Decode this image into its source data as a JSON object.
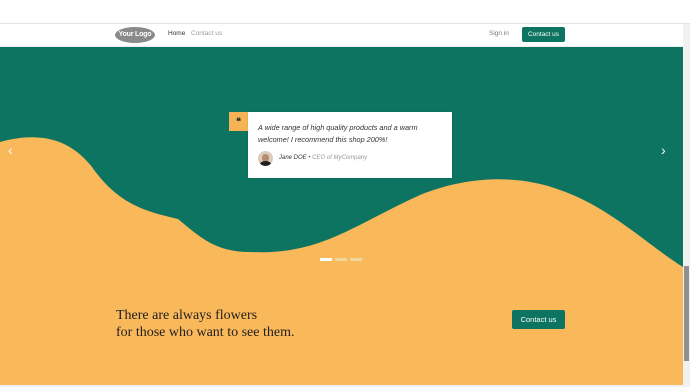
{
  "header": {
    "logo_text": "Your Logo",
    "nav": [
      {
        "label": "Home"
      },
      {
        "label": "Contact us"
      }
    ],
    "signin_label": "Sign in",
    "cta_label": "Contact us"
  },
  "colors": {
    "green": "#0e7462",
    "yellow": "#f9b85a",
    "badge": "#f5b355"
  },
  "carousel": {
    "quote_mark": "❝",
    "quote": "A wide range of high quality products and a warm welcome! I recommend this shop 200%!",
    "author": "Jane DOE",
    "separator": " • ",
    "role": "CEO of MyCompany",
    "prev_icon": "‹",
    "next_icon": "›"
  },
  "footer_section": {
    "tagline_line1": "There are always flowers",
    "tagline_line2": "for those who want to see them.",
    "cta_label": "Contact us"
  }
}
